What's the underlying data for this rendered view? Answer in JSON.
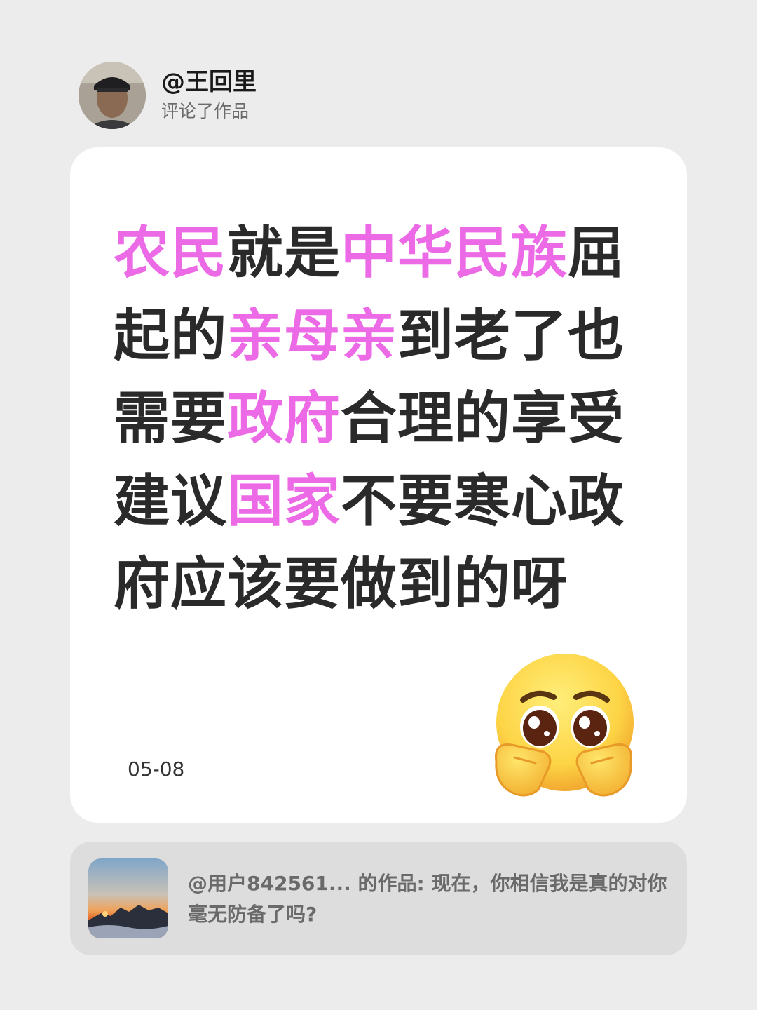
{
  "header": {
    "username": "@王回里",
    "action": "评论了作品"
  },
  "comment": {
    "segments": [
      {
        "text": "农民",
        "highlight": true
      },
      {
        "text": "就是",
        "highlight": false
      },
      {
        "text": "中华民族",
        "highlight": true
      },
      {
        "text": "屈起的",
        "highlight": false
      },
      {
        "text": "亲母亲",
        "highlight": true
      },
      {
        "text": "到老了也需要",
        "highlight": false
      },
      {
        "text": "政府",
        "highlight": true
      },
      {
        "text": "合理的享受建议",
        "highlight": false
      },
      {
        "text": "国家",
        "highlight": true
      },
      {
        "text": "不要寒心政府应该要做到的呀",
        "highlight": false
      }
    ],
    "date": "05-08",
    "emoji": "pleading-face-emoji"
  },
  "referenced_work": {
    "text": "@用户842561... 的作品: 现在，你相信我是真的对你毫无防备了吗?"
  },
  "colors": {
    "background": "#ececec",
    "card": "#ffffff",
    "highlight": "#ec6ae6",
    "text": "#2a2a2a"
  }
}
